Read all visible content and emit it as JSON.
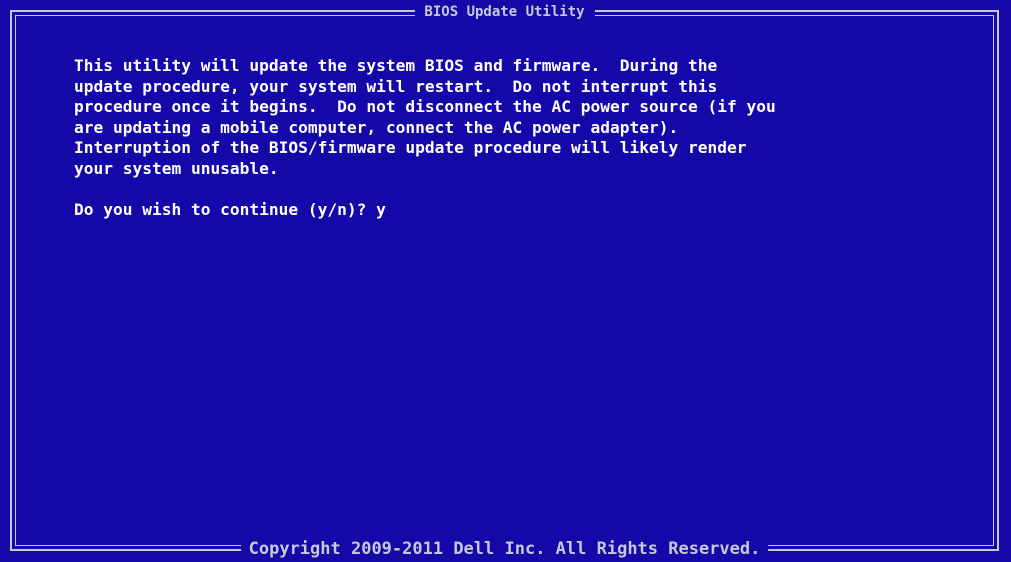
{
  "window": {
    "title": "BIOS Update Utility",
    "footer": "Copyright 2009-2011 Dell Inc.  All Rights Reserved."
  },
  "message": {
    "lines": [
      "This utility will update the system BIOS and firmware.  During the",
      "update procedure, your system will restart.  Do not interrupt this",
      "procedure once it begins.  Do not disconnect the AC power source (if you",
      "are updating a mobile computer, connect the AC power adapter).",
      "Interruption of the BIOS/firmware update procedure will likely render",
      "your system unusable."
    ]
  },
  "prompt": {
    "question": "Do you wish to continue (y/n)? ",
    "answer": "y"
  },
  "colors": {
    "background": "#1409a8",
    "text": "#ffffff",
    "border": "#c6c6d8"
  }
}
